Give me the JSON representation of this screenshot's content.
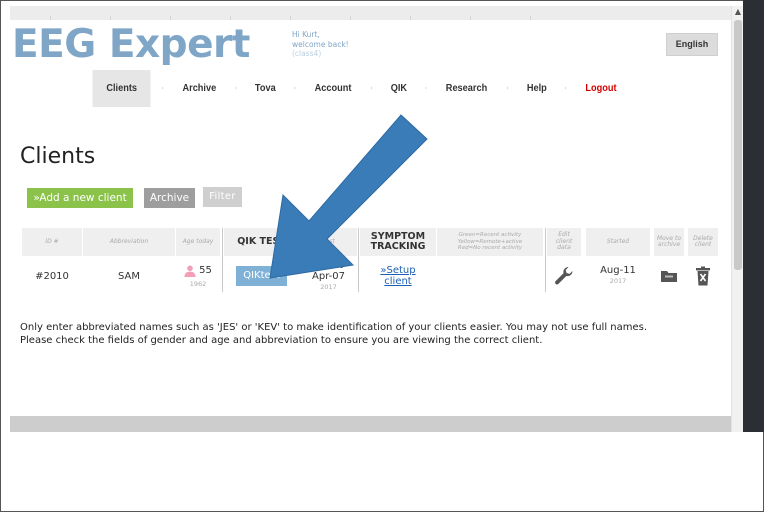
{
  "header": {
    "logo": "EEG Expert",
    "welcome_line1": "Hi Kurt,",
    "welcome_line2": "welcome back!",
    "welcome_line3": "(class4)",
    "language_button": "English"
  },
  "nav": {
    "items": [
      {
        "label": "Clients"
      },
      {
        "label": "Archive"
      },
      {
        "label": "Tova"
      },
      {
        "label": "Account"
      },
      {
        "label": "QIK"
      },
      {
        "label": "Research"
      },
      {
        "label": "Help"
      },
      {
        "label": "Logout"
      }
    ],
    "separator": "·"
  },
  "page": {
    "title": "Clients",
    "add_button": "»Add a new client",
    "archive_button": "Archive",
    "filter_button": "Filter"
  },
  "table": {
    "headers": {
      "id": "ID #",
      "abbreviation": "Abbreviation",
      "age": "Age today",
      "qik_test": "QIK TEST",
      "last": "Last",
      "symptom_line1": "SYMPTOM",
      "symptom_line2": "TRACKING",
      "legend_line1": "Green=Recent activity",
      "legend_line2": "Yellow=Remote+active",
      "legend_line3": "Red=No recent activity",
      "edit_line1": "Edit",
      "edit_line2": "client",
      "edit_line3": "data",
      "started": "Started",
      "move_line1": "Move to",
      "move_line2": "archive",
      "delete_line1": "Delete",
      "delete_line2": "client"
    },
    "rows": [
      {
        "id": "#2010",
        "abbreviation": "SAM",
        "age": "55",
        "birth_year": "1962",
        "qik_button": "QIKtest",
        "last_count": "1 test",
        "last_date": "Apr-07",
        "last_year": "2017",
        "symptom_link_line1": "»Setup",
        "symptom_link_line2": "client",
        "started_date": "Aug-11",
        "started_year": "2017"
      }
    ]
  },
  "note": {
    "line1": "Only enter abbreviated names such as 'JES' or 'KEV' to make identification of your clients easier. You may not use full names.",
    "line2": "Please check the fields of gender and age and abbreviation to ensure you are viewing the correct client."
  },
  "colors": {
    "logo": "#7fa6c7",
    "add_button": "#8bc34a",
    "archive_button": "#9e9e9e",
    "filter_button": "#cfcfcf",
    "qik_button": "#7fb1d6",
    "link": "#1a5fb4",
    "logout": "#d40000",
    "arrow": "#3a7cb8",
    "dark_panel": "#2b2e33"
  },
  "icons": {
    "person": "person-icon",
    "wrench": "wrench-icon",
    "folder": "folder-icon",
    "trash": "trash-icon",
    "arrow": "pointer-arrow-icon"
  }
}
